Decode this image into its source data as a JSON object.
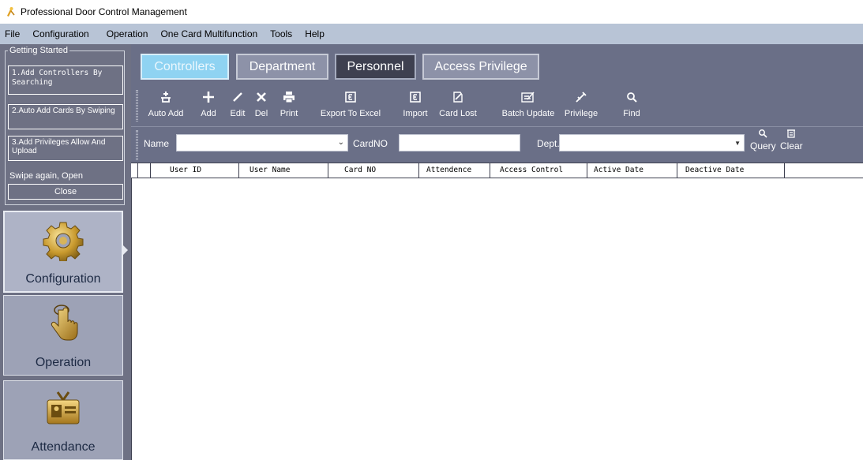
{
  "window": {
    "title": "Professional Door Control Management",
    "icon": "key-person-icon"
  },
  "menu": {
    "items": [
      "File",
      "Configuration",
      "Operation",
      "One Card Multifunction",
      "Tools",
      "Help"
    ]
  },
  "getting_started": {
    "legend": "Getting Started",
    "steps": [
      "1.Add Controllers By Searching",
      "2.Auto Add Cards By Swiping",
      "3.Add Privileges Allow And Upload"
    ],
    "swipe_text": "Swipe again, Open",
    "close_label": "Close"
  },
  "nav": {
    "tiles": [
      {
        "label": "Configuration",
        "icon": "gear-icon",
        "active": true
      },
      {
        "label": "Operation",
        "icon": "hand-pointer-icon",
        "active": false
      },
      {
        "label": "Attendance",
        "icon": "id-card-icon",
        "active": false
      }
    ]
  },
  "tabs": [
    {
      "label": "Controllers",
      "active": true
    },
    {
      "label": "Department",
      "active": false
    },
    {
      "label": "Personnel",
      "active": false
    },
    {
      "label": "Access Privilege",
      "active": false
    }
  ],
  "toolbar": {
    "buttons": [
      {
        "label": "Auto Add",
        "icon": "auto-add-icon"
      },
      {
        "label": "Add",
        "icon": "plus-icon"
      },
      {
        "label": "Edit",
        "icon": "pencil-icon"
      },
      {
        "label": "Del",
        "icon": "x-icon"
      },
      {
        "label": "Print",
        "icon": "printer-icon"
      },
      {
        "label": "Export To Excel",
        "icon": "excel-export-icon"
      },
      {
        "label": "Import",
        "icon": "excel-import-icon"
      },
      {
        "label": "Card Lost",
        "icon": "card-lost-icon"
      },
      {
        "label": "Batch Update",
        "icon": "batch-update-icon"
      },
      {
        "label": "Privilege",
        "icon": "privilege-icon"
      },
      {
        "label": "Find",
        "icon": "search-icon"
      }
    ]
  },
  "filter": {
    "name_label": "Name",
    "name_value": "",
    "cardno_label": "CardNO",
    "cardno_value": "",
    "dept_label": "Dept.",
    "dept_value": "",
    "query_label": "Query",
    "clear_label": "Clear"
  },
  "grid": {
    "columns": [
      "User ID",
      "User Name",
      "Card NO",
      "Attendence",
      "Access Control",
      "Active Date",
      "Deactive Date"
    ],
    "rows": []
  },
  "colors": {
    "menubar": "#b8c4d6",
    "panel": "#6a6f87",
    "left_panel": "#6e7184",
    "active_tab": "#8fd3f2"
  }
}
